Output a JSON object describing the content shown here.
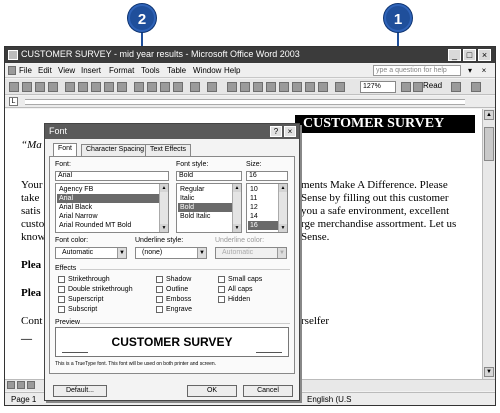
{
  "callouts": [
    "1",
    "2"
  ],
  "window": {
    "title": "CUSTOMER SURVEY - mid year results - Microsoft Office Word 2003",
    "controls": [
      "_",
      "□",
      "×"
    ]
  },
  "menu": {
    "items": [
      "File",
      "Edit",
      "View",
      "Insert",
      "Format",
      "Tools",
      "Table",
      "Window",
      "Help"
    ],
    "help_placeholder": "ype a question for help",
    "controls": [
      "▾",
      "×"
    ]
  },
  "toolbar": {
    "zoom": "127%",
    "read": "Read"
  },
  "document": {
    "title": "CUSTOMER SURVEY",
    "lines": [
      "“Ma",
      "Your",
      "take",
      "satis",
      "custo",
      "know",
      "Plea",
      "Plea",
      "Cont",
      "—"
    ],
    "right_lines": [
      "ments Make A Difference. Please",
      "Sense by filling out this customer",
      "you a safe environment, excellent",
      "rge merchandise assortment. Let us",
      "Sense.",
      "rselfer"
    ]
  },
  "statusbar": {
    "page": "Page 1",
    "lang": "English (U.S"
  },
  "dialog": {
    "title": "Font",
    "controls": [
      "?",
      "×"
    ],
    "tabs": [
      "Font",
      "Character Spacing",
      "Text Effects"
    ],
    "font_label": "Font:",
    "font_value": "Arial",
    "font_list": [
      "Agency FB",
      "Arial",
      "Arial Black",
      "Arial Narrow",
      "Arial Rounded MT Bold"
    ],
    "font_selected": "Arial",
    "style_label": "Font style:",
    "style_value": "Bold",
    "style_list": [
      "Regular",
      "Italic",
      "Bold",
      "Bold Italic"
    ],
    "style_selected": "Bold",
    "size_label": "Size:",
    "size_value": "16",
    "size_list": [
      "10",
      "11",
      "12",
      "14",
      "16"
    ],
    "size_selected": "16",
    "color_label": "Font color:",
    "color_value": "Automatic",
    "underline_label": "Underline style:",
    "underline_value": "(none)",
    "ucolor_label": "Underline color:",
    "ucolor_value": "Automatic",
    "effects_label": "Effects",
    "effects_col1": [
      "Strikethrough",
      "Double strikethrough",
      "Superscript",
      "Subscript"
    ],
    "effects_col2": [
      "Shadow",
      "Outline",
      "Emboss",
      "Engrave"
    ],
    "effects_col3": [
      "Small caps",
      "All caps",
      "Hidden"
    ],
    "preview_label": "Preview",
    "preview_text": "CUSTOMER SURVEY",
    "footnote": "This is a TrueType font. This font will be used on both printer and screen.",
    "default_button": "Default...",
    "ok_button": "OK",
    "cancel_button": "Cancel"
  }
}
